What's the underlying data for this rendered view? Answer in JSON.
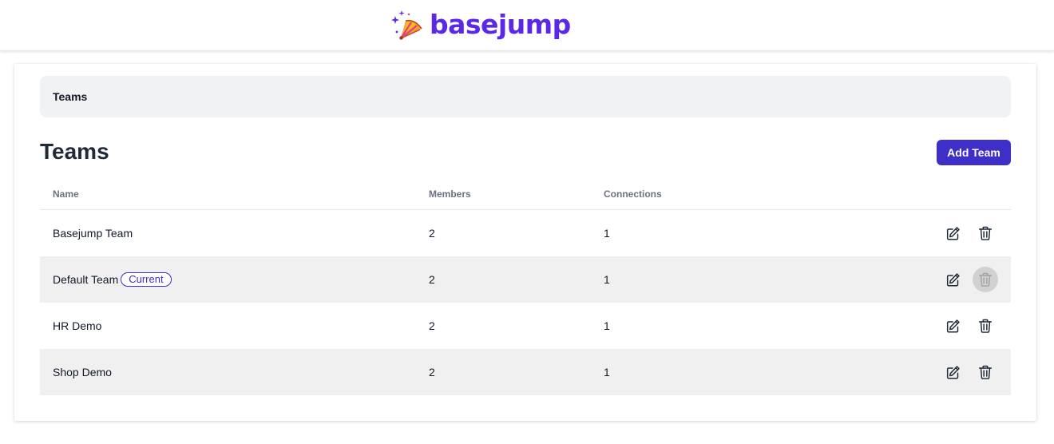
{
  "brand": {
    "name": "basejump",
    "logo_icon": "party-popper-icon",
    "color": "#5b28e6"
  },
  "breadcrumb": {
    "label": "Teams"
  },
  "page": {
    "title": "Teams",
    "add_button_label": "Add Team",
    "accent_color": "#3f2fc9"
  },
  "table": {
    "headers": {
      "name": "Name",
      "members": "Members",
      "connections": "Connections"
    },
    "rows": [
      {
        "name": "Basejump Team",
        "badge": "",
        "members": "2",
        "connections": "1",
        "delete_disabled": false
      },
      {
        "name": "Default Team",
        "badge": "Current",
        "members": "2",
        "connections": "1",
        "delete_disabled": true
      },
      {
        "name": "HR Demo",
        "badge": "",
        "members": "2",
        "connections": "1",
        "delete_disabled": false
      },
      {
        "name": "Shop Demo",
        "badge": "",
        "members": "2",
        "connections": "1",
        "delete_disabled": false
      }
    ],
    "row_actions": {
      "edit_icon": "pencil-square-icon",
      "delete_icon": "trash-icon"
    }
  }
}
